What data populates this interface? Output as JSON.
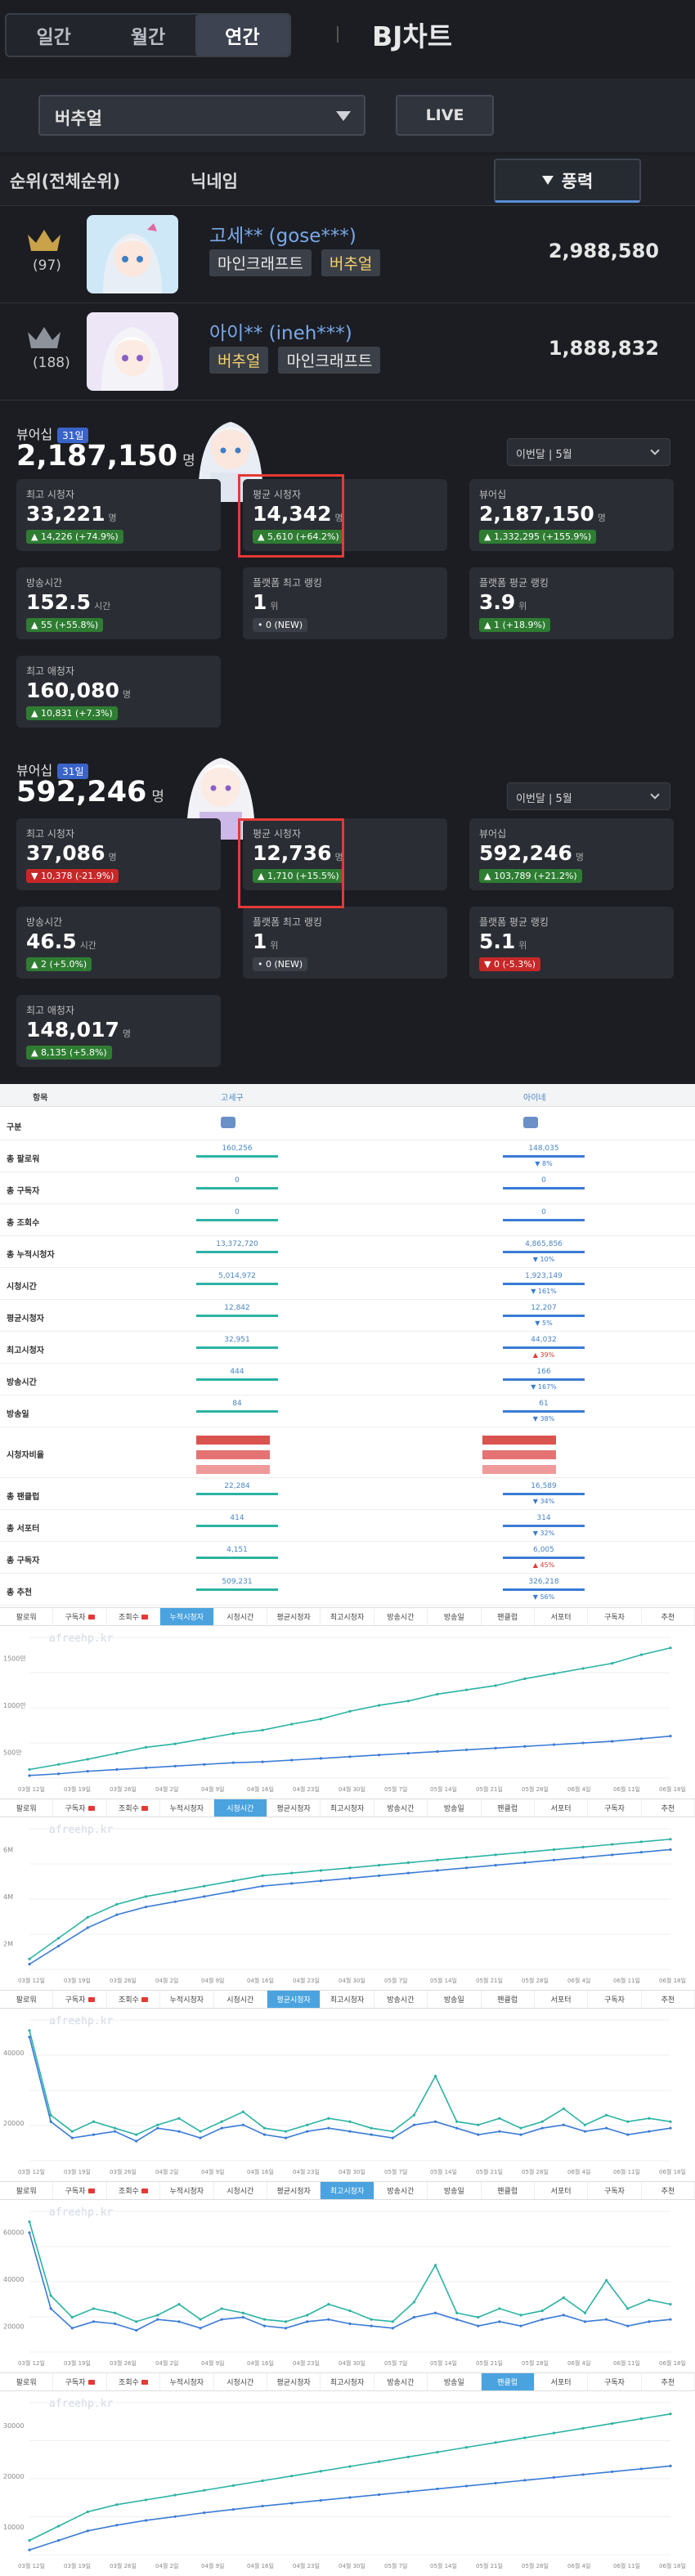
{
  "header": {
    "tabs": [
      {
        "label": "일간"
      },
      {
        "label": "월간"
      },
      {
        "label": "연간"
      }
    ],
    "title": "BJ차트"
  },
  "filter": {
    "dropdown": "버추얼",
    "live": "LIVE"
  },
  "table": {
    "rank_col": "순위(전체순위)",
    "nick_col": "닉네임",
    "sort_col": "풍력"
  },
  "rows": [
    {
      "rank": "(97)",
      "name": "고세** (gose***)",
      "tags": [
        "마인크래프트",
        "버추얼"
      ],
      "value": "2,988,580"
    },
    {
      "rank": "(188)",
      "name": "아이** (ineh***)",
      "tags": [
        "버추얼",
        "마인크래프트"
      ],
      "value": "1,888,832"
    }
  ],
  "stats": [
    {
      "label": "뷰어십",
      "badge": "31일",
      "total": "2,187,150",
      "unit": "명",
      "month": "이번달 | 5월",
      "cards": [
        {
          "label": "최고 시청자",
          "value": "33,221",
          "unit": "명",
          "delta": "▲ 14,226 (+74.9%)",
          "kind": "pos"
        },
        {
          "label": "평균 시청자",
          "value": "14,342",
          "unit": "명",
          "delta": "▲ 5,610 (+64.2%)",
          "kind": "pos"
        },
        {
          "label": "뷰어십",
          "value": "2,187,150",
          "unit": "명",
          "delta": "▲ 1,332,295 (+155.9%)",
          "kind": "pos"
        },
        {
          "label": "방송시간",
          "value": "152.5",
          "unit": "시간",
          "delta": "▲ 55 (+55.8%)",
          "kind": "pos"
        },
        {
          "label": "플랫폼 최고 랭킹",
          "value": "1",
          "unit": "위",
          "delta": "• 0 (NEW)",
          "kind": "zero"
        },
        {
          "label": "플랫폼 평균 랭킹",
          "value": "3.9",
          "unit": "위",
          "delta": "▲ 1 (+18.9%)",
          "kind": "pos"
        },
        {
          "label": "최고 애청자",
          "value": "160,080",
          "unit": "명",
          "delta": "▲ 10,831 (+7.3%)",
          "kind": "pos"
        }
      ]
    },
    {
      "label": "뷰어십",
      "badge": "31일",
      "total": "592,246",
      "unit": "명",
      "month": "이번달 | 5월",
      "cards": [
        {
          "label": "최고 시청자",
          "value": "37,086",
          "unit": "명",
          "delta": "▼ 10,378 (-21.9%)",
          "kind": "neg"
        },
        {
          "label": "평균 시청자",
          "value": "12,736",
          "unit": "명",
          "delta": "▲ 1,710 (+15.5%)",
          "kind": "pos"
        },
        {
          "label": "뷰어십",
          "value": "592,246",
          "unit": "명",
          "delta": "▲ 103,789 (+21.2%)",
          "kind": "pos"
        },
        {
          "label": "방송시간",
          "value": "46.5",
          "unit": "시간",
          "delta": "▲ 2 (+5.0%)",
          "kind": "pos"
        },
        {
          "label": "플랫폼 최고 랭킹",
          "value": "1",
          "unit": "위",
          "delta": "• 0 (NEW)",
          "kind": "zero"
        },
        {
          "label": "플랫폼 평균 랭킹",
          "value": "5.1",
          "unit": "위",
          "delta": "▼ 0 (-5.3%)",
          "kind": "neg"
        },
        {
          "label": "최고 애청자",
          "value": "148,017",
          "unit": "명",
          "delta": "▲ 8,135 (+5.8%)",
          "kind": "pos"
        }
      ]
    }
  ],
  "compare": {
    "head": [
      "항목",
      "고세구",
      "아이네"
    ],
    "rows": [
      {
        "label": "구분",
        "a": "",
        "b": "",
        "ad": "",
        "bd": ""
      },
      {
        "label": "총 팔로워",
        "a": "160,256",
        "b": "148,035",
        "ad": "",
        "bd": "▼ 8%"
      },
      {
        "label": "총 구독자",
        "a": "0",
        "b": "0",
        "ad": "",
        "bd": ""
      },
      {
        "label": "총 조회수",
        "a": "0",
        "b": "0",
        "ad": "",
        "bd": ""
      },
      {
        "label": "총 누적시청자",
        "a": "13,372,720",
        "b": "4,865,856",
        "ad": "",
        "bd": "▼ 10%"
      },
      {
        "label": "시청시간",
        "a": "5,014,972",
        "b": "1,923,149",
        "ad": "",
        "bd": "▼ 161%"
      },
      {
        "label": "평균시청자",
        "a": "12,842",
        "b": "12,207",
        "ad": "",
        "bd": "▼ 5%"
      },
      {
        "label": "최고시청자",
        "a": "32,951",
        "b": "44,032",
        "ad": "",
        "bd": "▲ 39%"
      },
      {
        "label": "방송시간",
        "a": "444",
        "b": "166",
        "ad": "",
        "bd": "▼ 167%"
      },
      {
        "label": "방송일",
        "a": "84",
        "b": "61",
        "ad": "",
        "bd": "▼ 38%"
      },
      {
        "label": "시청자비율",
        "a": "",
        "b": "",
        "ad": "",
        "bd": ""
      },
      {
        "label": "총 팬클럽",
        "a": "22,284",
        "b": "16,589",
        "ad": "",
        "bd": "▼ 34%"
      },
      {
        "label": "총 서포터",
        "a": "414",
        "b": "314",
        "ad": "",
        "bd": "▼ 32%"
      },
      {
        "label": "총 구독자",
        "a": "4,151",
        "b": "6,005",
        "ad": "",
        "bd": "▲ 45%"
      },
      {
        "label": "총 추천",
        "a": "509,231",
        "b": "326,218",
        "ad": "",
        "bd": "▼ 56%"
      }
    ]
  },
  "charts": {
    "tabs": [
      "팔로워",
      "구독자",
      "조회수",
      "누적시청자",
      "시청시간",
      "평균시청자",
      "최고시청자",
      "방송시간",
      "방송일",
      "팬클럽",
      "서포터",
      "구독자",
      "추천"
    ],
    "watermark": "afreehp.kr",
    "xlabels": [
      "03월 12일",
      "03월 19일",
      "03월 26일",
      "04월 2일",
      "04월 9일",
      "04월 16일",
      "04월 23일",
      "04월 30일",
      "05월 7일",
      "05월 14일",
      "05월 21일",
      "05월 28일",
      "06월 4일",
      "06월 11일",
      "06월 18일"
    ],
    "panels": [
      {
        "active": 3,
        "ylabels": [
          "1500만",
          "1000만",
          "500만"
        ]
      },
      {
        "active": 4,
        "ylabels": [
          "6M",
          "4M",
          "2M"
        ]
      },
      {
        "active": 5,
        "ylabels": [
          "40000",
          "20000"
        ]
      },
      {
        "active": 6,
        "ylabels": [
          "60000",
          "40000",
          "20000"
        ]
      },
      {
        "active": 9,
        "ylabels": [
          "30000",
          "20000",
          "10000"
        ]
      }
    ]
  },
  "chart_data": [
    {
      "type": "line",
      "title": "",
      "xlabel": "",
      "ylabel": "",
      "series": [
        {
          "values": [
            1.0,
            1.6,
            2.2,
            2.9,
            3.6,
            4.0,
            4.6,
            5.2,
            5.6,
            6.3,
            6.9,
            7.8,
            8.5,
            9.0,
            9.8,
            10.3,
            10.8,
            11.6,
            12.2,
            12.8,
            13.4,
            14.4,
            15.2
          ]
        },
        {
          "values": [
            0.3,
            0.5,
            0.8,
            1.0,
            1.2,
            1.4,
            1.6,
            1.8,
            1.9,
            2.1,
            2.3,
            2.5,
            2.7,
            2.9,
            3.1,
            3.3,
            3.5,
            3.7,
            3.9,
            4.1,
            4.3,
            4.6,
            4.9
          ]
        }
      ]
    },
    {
      "type": "line",
      "title": "",
      "xlabel": "",
      "ylabel": "",
      "series": [
        {
          "values": [
            0.4,
            1.2,
            2.0,
            2.5,
            2.8,
            3.0,
            3.2,
            3.4,
            3.6,
            3.7,
            3.8,
            3.9,
            4.0,
            4.1,
            4.2,
            4.3,
            4.4,
            4.5,
            4.6,
            4.7,
            4.8,
            4.9,
            5.0
          ]
        },
        {
          "values": [
            0.2,
            0.9,
            1.6,
            2.1,
            2.4,
            2.6,
            2.8,
            3.0,
            3.2,
            3.3,
            3.4,
            3.5,
            3.6,
            3.7,
            3.8,
            3.9,
            4.0,
            4.1,
            4.2,
            4.3,
            4.4,
            4.5,
            4.6
          ]
        }
      ]
    },
    {
      "type": "line",
      "title": "",
      "xlabel": "",
      "ylabel": "",
      "series": [
        {
          "values": [
            40000,
            14000,
            9000,
            12000,
            10000,
            8000,
            11000,
            13000,
            9000,
            12000,
            15000,
            10000,
            9000,
            11000,
            13000,
            12000,
            10000,
            9000,
            14000,
            26000,
            12000,
            11000,
            13000,
            10000,
            12000,
            16000,
            11000,
            14000,
            12000,
            13000,
            12000
          ]
        },
        {
          "values": [
            38000,
            12000,
            7000,
            8000,
            9000,
            6000,
            10000,
            9000,
            7000,
            10000,
            11000,
            8000,
            7000,
            9000,
            10000,
            9000,
            8000,
            7000,
            11000,
            12000,
            10000,
            8000,
            9000,
            8000,
            10000,
            11000,
            9000,
            10000,
            8000,
            9000,
            10000
          ]
        }
      ]
    },
    {
      "type": "line",
      "title": "",
      "xlabel": "",
      "ylabel": "",
      "series": [
        {
          "values": [
            60000,
            26000,
            16000,
            20000,
            18000,
            14000,
            17000,
            22000,
            15000,
            20000,
            18000,
            15000,
            14000,
            17000,
            22000,
            19000,
            15000,
            14000,
            23000,
            40000,
            18000,
            16000,
            20000,
            17000,
            19000,
            25000,
            18000,
            33000,
            20000,
            24000,
            22000
          ]
        },
        {
          "values": [
            55000,
            20000,
            11000,
            14000,
            13000,
            10000,
            15000,
            14000,
            11000,
            15000,
            16000,
            12000,
            11000,
            14000,
            15000,
            13000,
            12000,
            11000,
            16000,
            18000,
            15000,
            12000,
            14000,
            12000,
            15000,
            17000,
            14000,
            15000,
            12000,
            14000,
            15000
          ]
        }
      ]
    },
    {
      "type": "line",
      "title": "",
      "xlabel": "",
      "ylabel": "",
      "series": [
        {
          "values": [
            3000,
            6000,
            9000,
            10500,
            11500,
            12500,
            13500,
            14500,
            15500,
            16500,
            17500,
            18500,
            19500,
            20500,
            21500,
            22500,
            23500,
            24500,
            25500,
            26500,
            27500,
            28500,
            29500
          ]
        },
        {
          "values": [
            1000,
            3000,
            5000,
            6200,
            7200,
            8000,
            8800,
            9500,
            10200,
            10800,
            11400,
            12000,
            12600,
            13200,
            13800,
            14400,
            15000,
            15600,
            16200,
            16800,
            17400,
            18000,
            18600
          ]
        }
      ]
    }
  ],
  "colors": {
    "bg": "#1b1d22",
    "accent": "#5a8dd6",
    "series_a": "#2bb3a3",
    "series_b": "#3a7bd5",
    "pos": "#2e7d32",
    "neg": "#c62828"
  }
}
